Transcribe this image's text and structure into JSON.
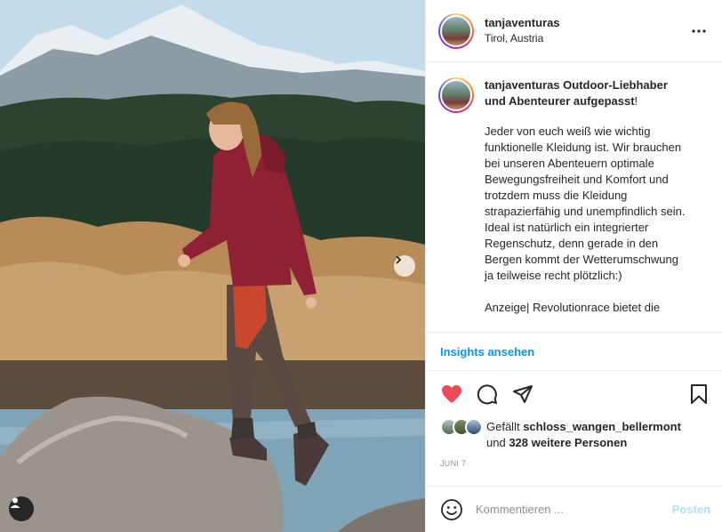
{
  "post": {
    "username": "tanjaventuras",
    "location": "Tirol, Austria",
    "more_label": "•••"
  },
  "caption": {
    "username": "tanjaventuras",
    "headline": "Outdoor-Liebhaber und Abenteurer aufgepasst",
    "headline_end": "!",
    "paragraph1": "Jeder von euch weiß wie wichtig funktionelle Kleidung ist. Wir brauchen bei unseren Abenteuern optimale Bewegungsfreiheit und Komfort und trotzdem muss die Kleidung strapazierfähig und unempfindlich sein. Ideal ist natürlich ein integrierter Regenschutz, denn gerade in den Bergen kommt der Wetterumschwung ja teilweise recht plötzlich:)",
    "paragraph2": "Anzeige| Revolutionrace bietet die"
  },
  "insights": {
    "label": "Insights ansehen"
  },
  "actions": {
    "like_icon": "heart-filled-icon",
    "comment_icon": "comment-icon",
    "share_icon": "paper-plane-icon",
    "save_icon": "bookmark-icon",
    "like_color": "#ed4956"
  },
  "likes": {
    "prefix": "Gefällt",
    "user": "schloss_wangen_bellermont",
    "connector": "und",
    "others": "328 weitere Personen"
  },
  "date": "JUNI 7",
  "comment": {
    "placeholder": "Kommentieren ...",
    "post_label": "Posten"
  },
  "colors": {
    "accent_blue": "#0095f6",
    "post_disabled": "#b2dffc",
    "text": "#262626",
    "muted": "#8e8e8e"
  }
}
